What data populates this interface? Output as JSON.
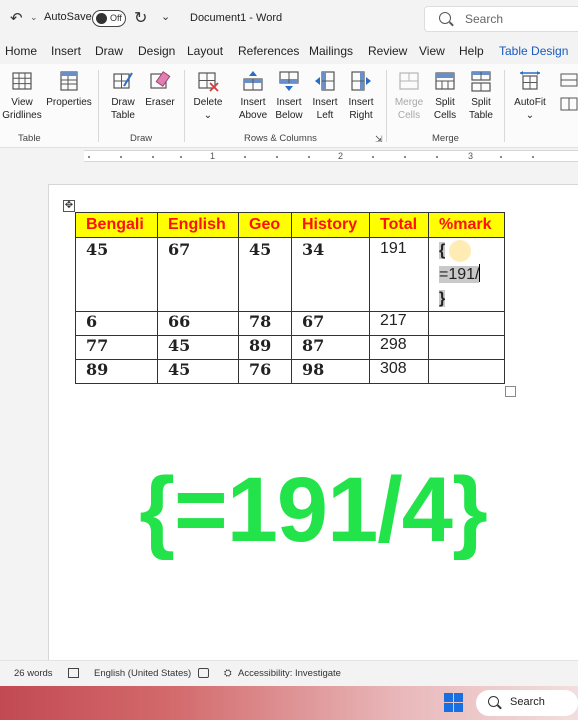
{
  "titlebar": {
    "autosave_label": "AutoSave",
    "autosave_state": "Off",
    "document_title": "Document1 - Word",
    "search_placeholder": "Search"
  },
  "tabs": [
    "Home",
    "Insert",
    "Draw",
    "Design",
    "Layout",
    "References",
    "Mailings",
    "Review",
    "View",
    "Help",
    "Table Design"
  ],
  "active_tab": "Table Design",
  "ribbon": {
    "groups": [
      {
        "label": "Table",
        "buttons": [
          {
            "line1": "View",
            "line2": "Gridlines",
            "icon": "gridlines-icon"
          },
          {
            "line1": "Properties",
            "line2": "",
            "icon": "properties-icon"
          }
        ]
      },
      {
        "label": "Draw",
        "buttons": [
          {
            "line1": "Draw",
            "line2": "Table",
            "icon": "draw-table-icon"
          },
          {
            "line1": "Eraser",
            "line2": "",
            "icon": "eraser-icon"
          }
        ]
      },
      {
        "label": "Rows & Columns",
        "buttons": [
          {
            "line1": "Delete",
            "line2": "⌄",
            "icon": "delete-table-icon"
          },
          {
            "line1": "Insert",
            "line2": "Above",
            "icon": "insert-above-icon"
          },
          {
            "line1": "Insert",
            "line2": "Below",
            "icon": "insert-below-icon"
          },
          {
            "line1": "Insert",
            "line2": "Left",
            "icon": "insert-left-icon"
          },
          {
            "line1": "Insert",
            "line2": "Right",
            "icon": "insert-right-icon"
          }
        ]
      },
      {
        "label": "Merge",
        "buttons": [
          {
            "line1": "Merge",
            "line2": "Cells",
            "icon": "merge-cells-icon",
            "disabled": true
          },
          {
            "line1": "Split",
            "line2": "Cells",
            "icon": "split-cells-icon"
          },
          {
            "line1": "Split",
            "line2": "Table",
            "icon": "split-table-icon"
          }
        ]
      },
      {
        "label": "",
        "buttons": [
          {
            "line1": "AutoFit",
            "line2": "⌄",
            "icon": "autofit-icon"
          }
        ]
      }
    ]
  },
  "ruler": {
    "numbers": [
      "1",
      "2",
      "3"
    ]
  },
  "table": {
    "headers": [
      "Bengali",
      "English",
      "Geo",
      "History",
      "Total",
      "%mark"
    ],
    "rows": [
      [
        "45",
        "67",
        "45",
        "34",
        "191",
        ""
      ],
      [
        "6",
        "66",
        "78",
        "67",
        "217",
        ""
      ],
      [
        "77",
        "45",
        "89",
        "87",
        "298",
        ""
      ],
      [
        "89",
        "45",
        "76",
        "98",
        "308",
        ""
      ]
    ],
    "field_code": {
      "open": "{",
      "body": "=191/",
      "close": "}"
    }
  },
  "overlay_formula": "{=191/4}",
  "status": {
    "words": "26 words",
    "language": "English (United States)",
    "accessibility": "Accessibility: Investigate"
  },
  "taskbar": {
    "search_label": "Search"
  },
  "colors": {
    "header_fill": "#ffff00",
    "header_text": "#ff1010",
    "formula": "#22e34a",
    "accent": "#185abd"
  }
}
